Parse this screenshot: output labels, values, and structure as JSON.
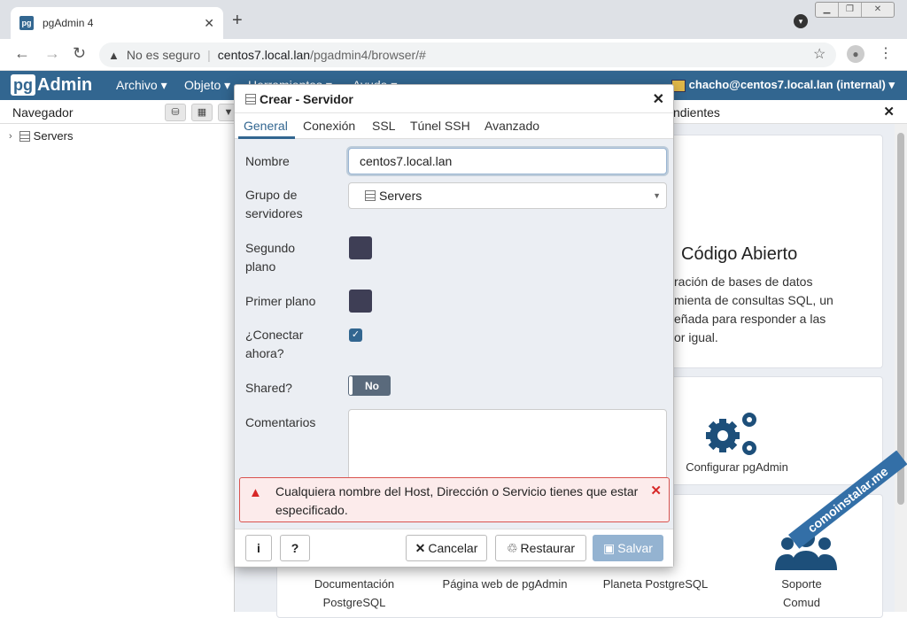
{
  "browser": {
    "tab_title": "pgAdmin 4",
    "favicon_text": "pg",
    "not_secure": "No es seguro",
    "url_host": "centos7.local.lan",
    "url_path": "/pgadmin4/browser/#"
  },
  "app": {
    "logo_pg": "pg",
    "logo_admin": "Admin",
    "menu": [
      "Archivo",
      "Objeto",
      "Herramientas",
      "Ayuda"
    ],
    "user": "chacho@centos7.local.lan (internal)"
  },
  "browser_panel": {
    "title": "Navegador",
    "tree_root": "Servers"
  },
  "dashboard": {
    "tab_label": "ndientes",
    "heading": "Código Abierto",
    "text_lines": [
      "ración de bases de datos",
      "mienta de consultas SQL, un",
      "eñada para responder a las",
      "or igual."
    ],
    "configure_label": "Configurar pgAdmin",
    "links": [
      "Documentación PostgreSQL",
      "Página web de pgAdmin",
      "Planeta PostgreSQL",
      "Soporte de la Comunidad"
    ],
    "links_visible": [
      "Documentación",
      "PostgreSQL",
      "Página web de pgAdmin",
      "Planeta PostgreSQL",
      "Soporte",
      "Comu",
      "d"
    ]
  },
  "dialog": {
    "title": "Crear - Servidor",
    "tabs": [
      "General",
      "Conexión",
      "SSL",
      "Túnel SSH",
      "Avanzado"
    ],
    "active_tab": "General",
    "fields": {
      "name_label": "Nombre",
      "name_value": "centos7.local.lan",
      "group_label_1": "Grupo de",
      "group_label_2": "servidores",
      "group_value": "Servers",
      "bg_label_1": "Segundo",
      "bg_label_2": "plano",
      "fg_label": "Primer plano",
      "connect_label_1": "¿Conectar",
      "connect_label_2": "ahora?",
      "shared_label": "Shared?",
      "shared_value": "No",
      "comments_label": "Comentarios"
    },
    "error_line_1": "Cualquiera nombre del Host, Dirección o Servicio tienes que estar",
    "error_line_2": "especificado.",
    "footer": {
      "info": "i",
      "help": "?",
      "cancel": "Cancelar",
      "restore": "Restaurar",
      "save": "Salvar"
    }
  },
  "watermark": "comoinstalar.me",
  "colors": {
    "header_blue": "#326690",
    "swatch": "#3e3e55",
    "error_red": "#d72828"
  }
}
